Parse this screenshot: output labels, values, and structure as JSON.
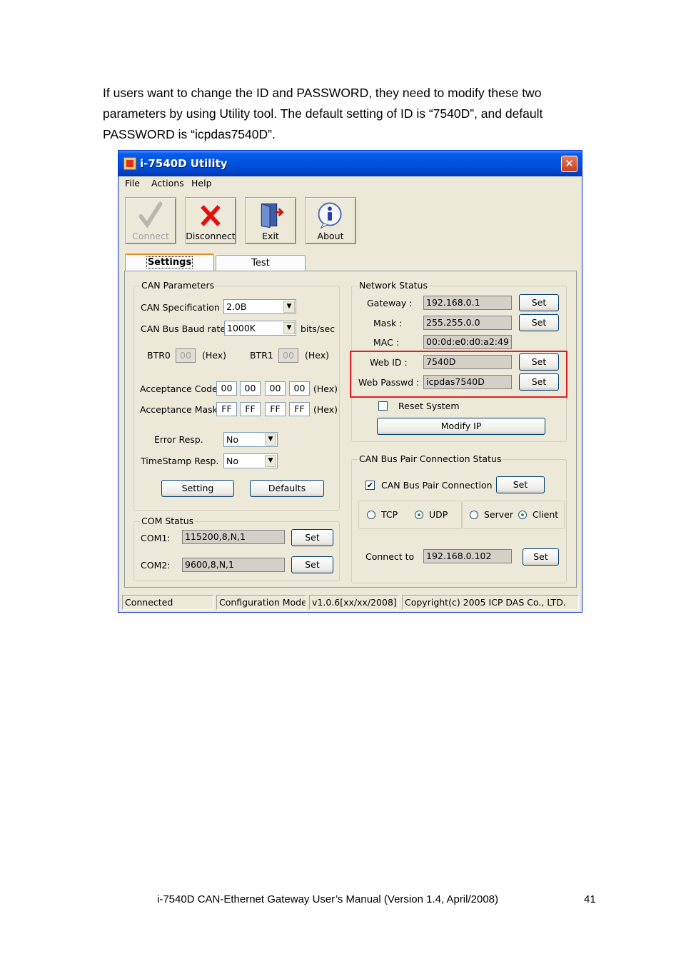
{
  "paragraph": {
    "line1": "If users want to change the ID and PASSWORD, they need to modify these two",
    "line2": "parameters by using Utility tool. The default setting of ID is “7540D”, and default",
    "line3": "PASSWORD is “icpdas7540D”."
  },
  "window": {
    "title": "i-7540D Utility",
    "close_glyph": "✕",
    "menu": [
      "File",
      "Actions",
      "Help"
    ],
    "toolbar": [
      {
        "label": "Connect",
        "icon": "checkmark-icon",
        "enabled": false
      },
      {
        "label": "Disconnect",
        "icon": "red-x-icon",
        "enabled": true
      },
      {
        "label": "Exit",
        "icon": "exit-door-icon",
        "enabled": true
      },
      {
        "label": "About",
        "icon": "info-icon",
        "enabled": true
      }
    ],
    "tabs": [
      "Settings",
      "Test"
    ],
    "can_parameters": {
      "title": "CAN Parameters",
      "spec_label": "CAN Specification",
      "spec_value": "2.0B",
      "baud_label": "CAN Bus Baud rate",
      "baud_value": "1000K",
      "baud_unit": "bits/sec",
      "btr0_label": "BTR0",
      "btr0_value": "00",
      "btr1_label": "BTR1",
      "btr1_value": "00",
      "hex": "(Hex)",
      "acc_code_label": "Acceptance Code",
      "acc_code": [
        "00",
        "00",
        "00",
        "00"
      ],
      "acc_mask_label": "Acceptance Mask",
      "acc_mask": [
        "FF",
        "FF",
        "FF",
        "FF"
      ],
      "error_label": "Error Resp.",
      "error_value": "No",
      "timestamp_label": "TimeStamp Resp.",
      "timestamp_value": "No",
      "setting_btn": "Setting",
      "defaults_btn": "Defaults"
    },
    "com_status": {
      "title": "COM Status",
      "com1_label": "COM1:",
      "com1_value": "115200,8,N,1",
      "com2_label": "COM2:",
      "com2_value": "9600,8,N,1",
      "set": "Set"
    },
    "network_status": {
      "title": "Network Status",
      "gateway_label": "Gateway :",
      "gateway_value": "192.168.0.1",
      "mask_label": "Mask :",
      "mask_value": "255.255.0.0",
      "mac_label": "MAC :",
      "mac_value": "00:0d:e0:d0:a2:49",
      "webid_label": "Web ID :",
      "webid_value": "7540D",
      "webpass_label": "Web Passwd :",
      "webpass_value": "icpdas7540D",
      "set": "Set",
      "reset_label": "Reset System",
      "modify_btn": "Modify IP"
    },
    "pair_status": {
      "title": "CAN Bus Pair Connection Status",
      "pair_label": "CAN Bus Pair Connection",
      "pair_checked": true,
      "set": "Set",
      "tcp": "TCP",
      "udp": "UDP",
      "server": "Server",
      "client": "Client",
      "connect_label": "Connect to",
      "connect_value": "192.168.0.102"
    },
    "statusbar": [
      "Connected",
      "Configuration Mode",
      "v1.0.6[xx/xx/2008]",
      "Copyright(c) 2005 ICP DAS Co., LTD."
    ]
  },
  "footer": {
    "text": "i-7540D CAN-Ethernet Gateway User’s Manual (Version 1.4, April/2008)",
    "page": "41"
  }
}
